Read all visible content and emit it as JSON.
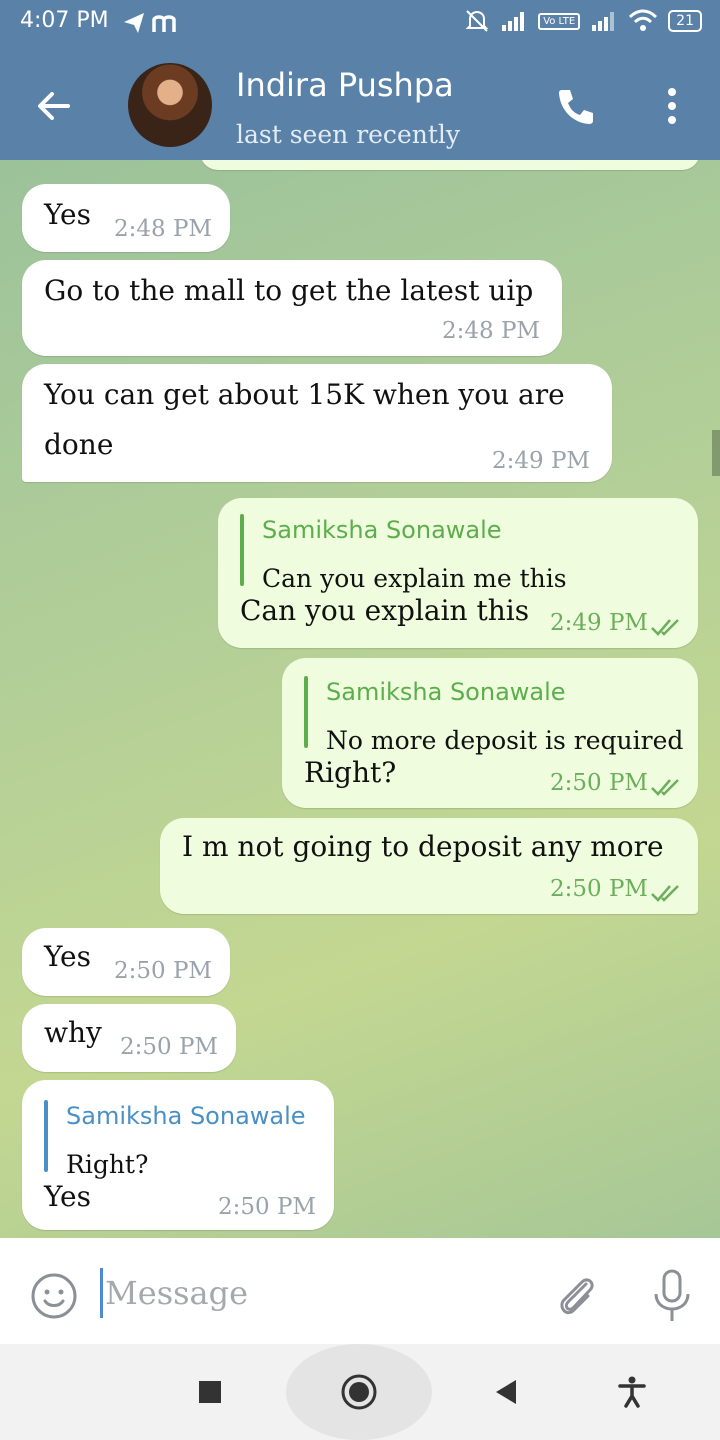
{
  "status_bar": {
    "time": "4:07 PM",
    "battery": "21",
    "volte_label": "Vo LTE"
  },
  "header": {
    "contact_name": "Indira Pushpa",
    "contact_status": "last seen recently"
  },
  "messages": [
    {
      "direction": "in",
      "text": "Yes",
      "time": "2:48 PM"
    },
    {
      "direction": "in",
      "text": "Go to the mall to get the latest uip",
      "time": "2:48 PM"
    },
    {
      "direction": "in",
      "text_line1": "You can get about 15K when you are",
      "text_line2": "done",
      "time": "2:49 PM"
    },
    {
      "direction": "out",
      "reply_name": "Samiksha Sonawale",
      "reply_text": "Can you explain me this",
      "text": "Can you explain this",
      "time": "2:49 PM",
      "status": "read"
    },
    {
      "direction": "out",
      "reply_name": "Samiksha Sonawale",
      "reply_text": "No more deposit is required",
      "text": "Right?",
      "time": "2:50 PM",
      "status": "read"
    },
    {
      "direction": "out",
      "text": "I m not going to deposit any more",
      "time": "2:50 PM",
      "status": "read"
    },
    {
      "direction": "in",
      "text": "Yes",
      "time": "2:50 PM"
    },
    {
      "direction": "in",
      "text": "why",
      "time": "2:50 PM"
    },
    {
      "direction": "in",
      "reply_name": "Samiksha Sonawale",
      "reply_text": "Right?",
      "text": "Yes",
      "time": "2:50 PM"
    }
  ],
  "input": {
    "placeholder": "Message"
  },
  "colors": {
    "header": "#5a82a8",
    "incoming_bubble": "#ffffff",
    "outgoing_bubble": "#effdde",
    "outgoing_meta": "#6cae5c",
    "reply_in": "#4a90c6",
    "reply_out": "#5cae4c"
  },
  "icons": [
    "back-arrow-icon",
    "phone-icon",
    "more-vertical-icon",
    "emoji-icon",
    "paperclip-icon",
    "microphone-icon",
    "read-ticks-icon",
    "recents-icon",
    "home-icon",
    "back-triangle-icon",
    "accessibility-icon"
  ]
}
